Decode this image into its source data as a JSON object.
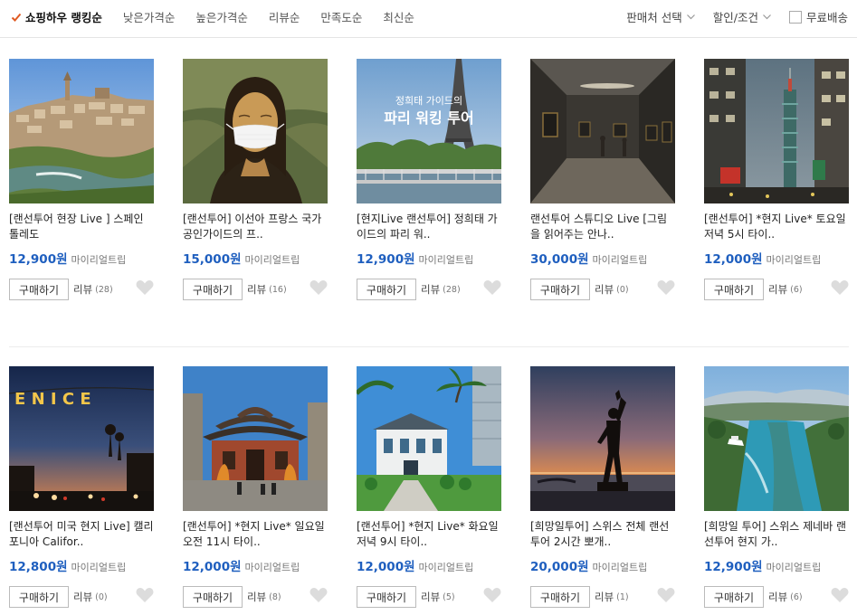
{
  "sort_bar": {
    "items": [
      "쇼핑하우 랭킹순",
      "낮은가격순",
      "높은가격순",
      "리뷰순",
      "만족도순",
      "최신순"
    ],
    "filters": {
      "seller_select": "판매처 선택",
      "discount": "할인/조건",
      "free_shipping": "무료배송"
    }
  },
  "labels": {
    "buy": "구매하기",
    "review": "리뷰"
  },
  "colors": {
    "price": "#1f5fbf",
    "accent_check": "#e05a22"
  },
  "products": [
    {
      "title": "[랜선투어 현장 Live ] 스페인 톨레도",
      "price": "12,900원",
      "seller": "마이리얼트립",
      "reviews": "(28)"
    },
    {
      "title": "[랜선투어] 이선아 프랑스 국가공인가이드의 프..",
      "price": "15,000원",
      "seller": "마이리얼트립",
      "reviews": "(16)"
    },
    {
      "title": "[현지Live 랜선투어] 정희태 가이드의 파리 워..",
      "price": "12,900원",
      "seller": "마이리얼트립",
      "reviews": "(28)",
      "thumb_text": [
        "정희태 가이드의",
        "파리 워킹 투어"
      ]
    },
    {
      "title": "랜선투어 스튜디오 Live [그림을 읽어주는 안나..",
      "price": "30,000원",
      "seller": "마이리얼트립",
      "reviews": "(0)"
    },
    {
      "title": "[랜선투어] *현지 Live* 토요일 저녁 5시 타이..",
      "price": "12,000원",
      "seller": "마이리얼트립",
      "reviews": "(6)"
    },
    {
      "title": "[랜선투어 미국 현지 Live] 캘리포니아 Califor..",
      "price": "12,800원",
      "seller": "마이리얼트립",
      "reviews": "(0)",
      "thumb_text": [
        "E N I C E"
      ]
    },
    {
      "title": "[랜선투어] *현지 Live* 일요일 오전 11시 타이..",
      "price": "12,000원",
      "seller": "마이리얼트립",
      "reviews": "(8)"
    },
    {
      "title": "[랜선투어] *현지 Live* 화요일 저녁 9시 타이..",
      "price": "12,000원",
      "seller": "마이리얼트립",
      "reviews": "(5)"
    },
    {
      "title": "[희망일투어] 스위스 전체 랜선투어 2시간 뽀개..",
      "price": "20,000원",
      "seller": "마이리얼트립",
      "reviews": "(1)"
    },
    {
      "title": "[희망일 투어] 스위스 제네바 랜선투어 현지 가..",
      "price": "12,900원",
      "seller": "마이리얼트립",
      "reviews": "(6)"
    }
  ]
}
